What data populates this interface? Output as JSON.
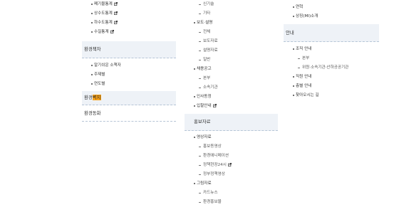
{
  "col1": {
    "top_items": [
      {
        "label": "폐기물통계",
        "ext": true
      },
      {
        "label": "상수도통계",
        "ext": true
      },
      {
        "label": "하수도통계",
        "ext": true
      },
      {
        "label": "수질통계",
        "ext": true
      }
    ],
    "sections": [
      {
        "title": "환경책자",
        "items": [
          "알기쉬운 소책자",
          "주제별",
          "연도별"
        ]
      },
      {
        "title_prefix": "환경",
        "title_highlight": "벽지"
      },
      {
        "title": "환경동화"
      }
    ]
  },
  "col2": {
    "items_a": [
      {
        "level": 2,
        "label": "신기술"
      },
      {
        "level": 2,
        "label": "기타"
      },
      {
        "level": 1,
        "label": "보도·설명"
      },
      {
        "level": 2,
        "label": "전체"
      },
      {
        "level": 2,
        "label": "보도자료"
      },
      {
        "level": 2,
        "label": "설명자료"
      },
      {
        "level": 2,
        "label": "일반"
      },
      {
        "level": 1,
        "label": "채용공고"
      },
      {
        "level": 2,
        "label": "본부"
      },
      {
        "level": 2,
        "label": "소속기관"
      },
      {
        "level": 1,
        "label": "인사동정"
      },
      {
        "level": 1,
        "label": "입찰안내",
        "ext": true
      }
    ],
    "section_title": "홍보자료",
    "items_b": [
      {
        "level": 1,
        "label": "영상자료"
      },
      {
        "level": 2,
        "label": "홍보동영상"
      },
      {
        "level": 2,
        "label": "환경애니메이션"
      },
      {
        "level": 2,
        "label": "정책현장24시",
        "ext": true
      },
      {
        "level": 2,
        "label": "정부정책영상"
      },
      {
        "level": 1,
        "label": "그림자료"
      },
      {
        "level": 2,
        "label": "카드뉴스"
      },
      {
        "level": 2,
        "label": "환경홍보물"
      }
    ]
  },
  "col3": {
    "items_a": [
      {
        "level": 1,
        "label": "연혁"
      },
      {
        "level": 1,
        "label": "상징(MI)소개"
      }
    ],
    "section_title": "안내",
    "items_b": [
      {
        "level": 1,
        "label": "조직 안내"
      },
      {
        "level": 2,
        "label": "본부"
      },
      {
        "level": 2,
        "label": "위원·소속기관·산하공공기관"
      },
      {
        "level": 1,
        "label": "직원 안내"
      },
      {
        "level": 1,
        "label": "층별 안내"
      },
      {
        "level": 1,
        "label": "찾아오시는 길"
      }
    ]
  },
  "icons": {
    "external": "external-link-icon"
  },
  "colors": {
    "highlight": "#f7a21b",
    "section_bg": "#eef2f7",
    "divider": "#b6c5d6"
  }
}
